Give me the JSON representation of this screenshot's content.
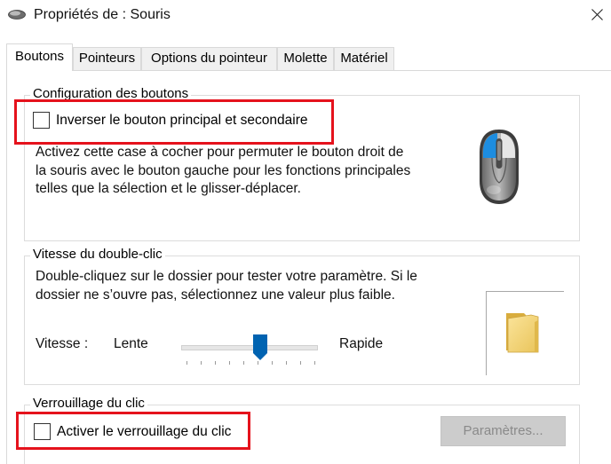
{
  "window": {
    "title": "Propriétés de : Souris",
    "app_icon": "mouse-icon",
    "close_icon": "close-icon"
  },
  "tabs": [
    {
      "label": "Boutons",
      "active": true
    },
    {
      "label": "Pointeurs",
      "active": false
    },
    {
      "label": "Options du pointeur",
      "active": false
    },
    {
      "label": "Molette",
      "active": false
    },
    {
      "label": "Matériel",
      "active": false
    }
  ],
  "buttons_config": {
    "legend": "Configuration des boutons",
    "checkbox_label": "Inverser le bouton principal et secondaire",
    "checked": false,
    "description_lines": [
      "Activez cette case à cocher pour permuter le bouton droit de",
      "la souris avec le bouton gauche pour les fonctions principales",
      "telles que la sélection et le glisser-déplacer."
    ],
    "image": "mouse-illustration"
  },
  "double_click": {
    "legend": "Vitesse du double-clic",
    "description_lines": [
      "Double-cliquez sur le dossier pour tester votre paramètre. Si le",
      "dossier ne s’ouvre pas, sélectionnez une valeur plus faible."
    ],
    "speed_label": "Vitesse :",
    "slow_label": "Lente",
    "fast_label": "Rapide",
    "slider_level": 0.58,
    "test_icon": "folder-icon"
  },
  "click_lock": {
    "legend": "Verrouillage du clic",
    "checkbox_label": "Activer le verrouillage du clic",
    "checked": false,
    "settings_button": "Paramètres...",
    "settings_enabled": false
  },
  "colors": {
    "highlight": "#e5121c",
    "accent": "#0063b1"
  }
}
